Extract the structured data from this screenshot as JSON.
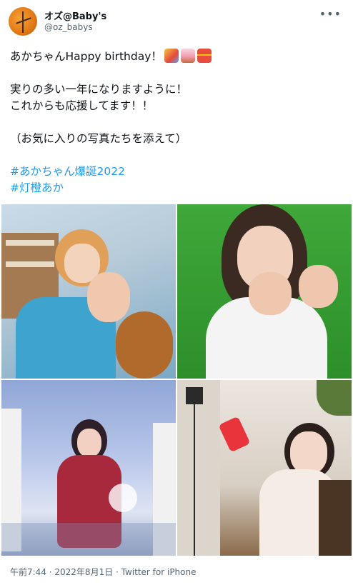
{
  "tweet": {
    "display_name": "オズ@Baby's",
    "handle": "@oz_babys",
    "more_icon": "more-horizontal-icon",
    "lines": [
      "あかちゃんHappy birthday！",
      "実りの多い一年になりますように！",
      "これからも応援してます！！",
      "（お気に入りの写真たちを添えて）"
    ],
    "emojis": [
      "party-popper",
      "birthday-cake",
      "wrapped-gift"
    ],
    "hashtags": [
      "#あかちゃん爆誕2022",
      "#灯橙あか"
    ],
    "footer": "午前7:44 · 2022年8月1日 · Twitter for iPhone"
  },
  "colors": {
    "text": "#0f1419",
    "secondary": "#536471",
    "link": "#1d9bf0"
  }
}
